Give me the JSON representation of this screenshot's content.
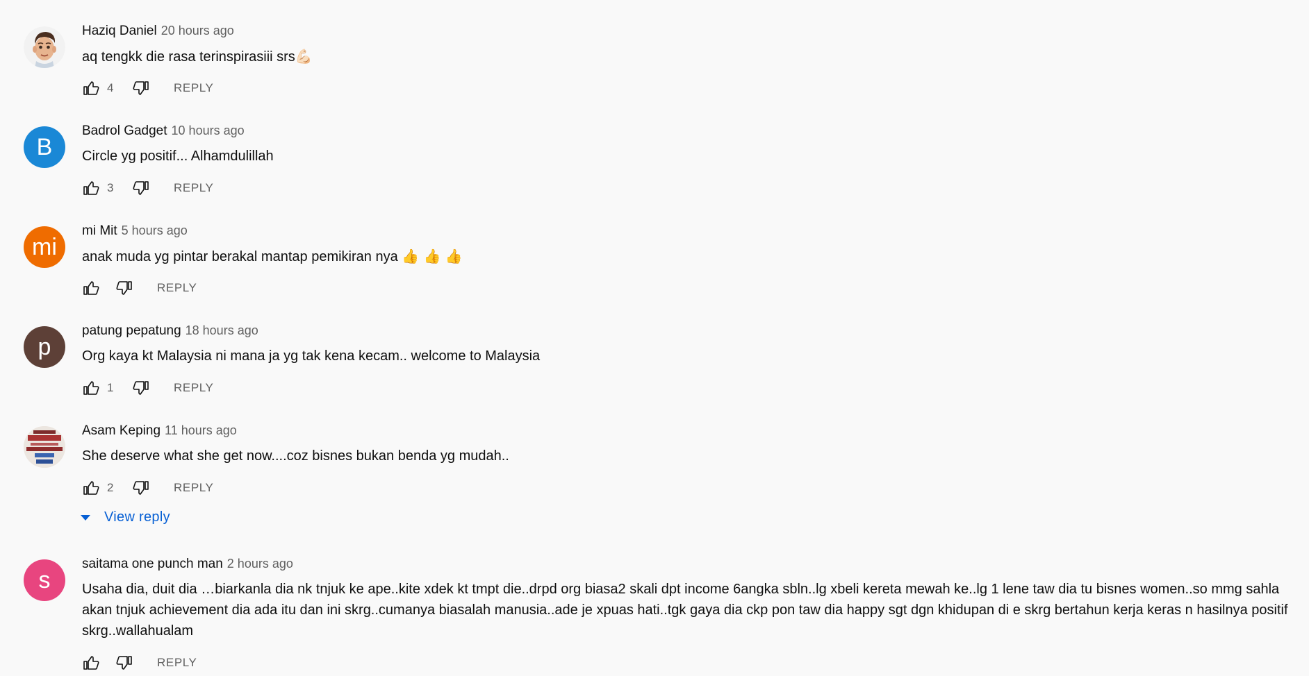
{
  "comments": [
    {
      "author": "Haziq Daniel",
      "timestamp": "20 hours ago",
      "text": "aq tengkk die rasa terinspirasiii srs",
      "emoji": "💪🏻",
      "likes": "4",
      "reply_label": "REPLY",
      "avatar": {
        "type": "illustration",
        "icon": "memoji-face"
      }
    },
    {
      "author": "Badrol Gadget",
      "timestamp": "10 hours ago",
      "text": "Circle yg positif... Alhamdulillah",
      "likes": "3",
      "reply_label": "REPLY",
      "avatar": {
        "type": "letter",
        "letter": "B",
        "color": "#1a88d6"
      }
    },
    {
      "author": "mi Mit",
      "timestamp": "5 hours ago",
      "text": "anak muda yg pintar berakal mantap pemikiran nya",
      "emoji": "👍 👍 👍",
      "likes": "",
      "reply_label": "REPLY",
      "avatar": {
        "type": "letter",
        "letter": "mi",
        "color": "#ef6c00"
      }
    },
    {
      "author": "patung pepatung",
      "timestamp": "18 hours ago",
      "text": "Org kaya kt Malaysia ni mana ja yg tak kena kecam.. welcome to Malaysia",
      "likes": "1",
      "reply_label": "REPLY",
      "avatar": {
        "type": "letter",
        "letter": "p",
        "color": "#5d4037"
      }
    },
    {
      "author": "Asam Keping",
      "timestamp": "11 hours ago",
      "text": "She deserve what she get now....coz bisnes bukan benda yg mudah..",
      "likes": "2",
      "reply_label": "REPLY",
      "view_reply": "View reply",
      "avatar": {
        "type": "image",
        "icon": "positive-text-image"
      }
    },
    {
      "author": "saitama one punch man",
      "timestamp": "2 hours ago",
      "text": "Usaha dia, duit dia …biarkanla dia nk tnjuk ke ape..kite xdek kt tmpt die..drpd org biasa2 skali dpt income 6angka sbln..lg xbeli kereta mewah ke..lg 1 lene taw dia tu bisnes women..so mmg sahla akan tnjuk achievement dia ada itu dan ini skrg..cumanya biasalah manusia..ade je xpuas hati..tgk gaya dia ckp pon taw dia happy sgt dgn khidupan di e skrg bertahun kerja keras n hasilnya positif skrg..wallahualam",
      "likes": "",
      "reply_label": "REPLY",
      "avatar": {
        "type": "letter",
        "letter": "s",
        "color": "#e8457f"
      }
    }
  ],
  "icons": {
    "like": "thumb-up-icon",
    "dislike": "thumb-down-icon",
    "expand": "caret-down-icon"
  },
  "colors": {
    "background": "#f9f9f9",
    "link": "#065fd4",
    "secondary_text": "#606060"
  }
}
